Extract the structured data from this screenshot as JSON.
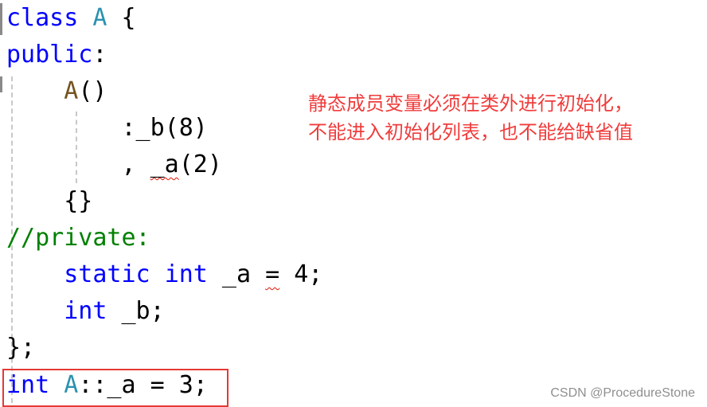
{
  "editor": {
    "language": "C++",
    "lines": [
      {
        "tokens": [
          {
            "t": "class",
            "k": "kw"
          },
          {
            "t": " "
          },
          {
            "t": "A",
            "k": "cls"
          },
          {
            "t": " {"
          }
        ]
      },
      {
        "tokens": [
          {
            "t": "public",
            "k": "kw"
          },
          {
            "t": ":"
          }
        ]
      },
      {
        "tokens": [
          {
            "t": "    "
          },
          {
            "t": "A",
            "k": "fn"
          },
          {
            "t": "()"
          }
        ]
      },
      {
        "tokens": [
          {
            "t": "        :_b(8)"
          }
        ]
      },
      {
        "tokens": [
          {
            "t": "        , "
          },
          {
            "t": "_a",
            "k": "squig"
          },
          {
            "t": "(2)"
          }
        ]
      },
      {
        "tokens": [
          {
            "t": "    {}"
          }
        ]
      },
      {
        "tokens": [
          {
            "t": "//private:",
            "k": "cm"
          }
        ]
      },
      {
        "tokens": [
          {
            "t": "    "
          },
          {
            "t": "static",
            "k": "kw"
          },
          {
            "t": " "
          },
          {
            "t": "int",
            "k": "kw"
          },
          {
            "t": " _a "
          },
          {
            "t": "=",
            "k": "squig"
          },
          {
            "t": " 4;"
          }
        ]
      },
      {
        "tokens": [
          {
            "t": "    "
          },
          {
            "t": "int",
            "k": "kw"
          },
          {
            "t": " _b;"
          }
        ]
      },
      {
        "tokens": [
          {
            "t": "};"
          }
        ]
      },
      {
        "tokens": [
          {
            "t": "int",
            "k": "kw"
          },
          {
            "t": " "
          },
          {
            "t": "A",
            "k": "cls"
          },
          {
            "t": "::_a = 3;"
          }
        ]
      }
    ],
    "highlighted_line_index": 10
  },
  "annotation": {
    "text": "静态成员变量必须在类外进行初始化，\n不能进入初始化列表，也不能给缺省值",
    "color": "#f03c3c"
  },
  "highlight_box_color": "#e53935",
  "watermark": "CSDN @ProcedureStone",
  "colors": {
    "keyword": "#0000ff",
    "class_name": "#2b91af",
    "function": "#74531f",
    "comment": "#008000",
    "error_squiggle": "#e51400"
  }
}
